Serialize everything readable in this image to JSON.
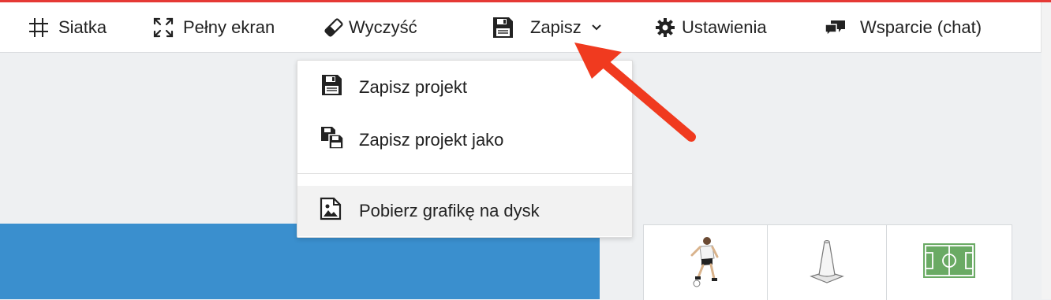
{
  "toolbar": {
    "items": [
      {
        "label": "Siatka",
        "icon": "grid-icon"
      },
      {
        "label": "Pełny ekran",
        "icon": "fullscreen-icon"
      },
      {
        "label": "Wyczyść",
        "icon": "eraser-icon"
      },
      {
        "label": "Zapisz",
        "icon": "floppy-disk-icon",
        "has_dropdown": true
      },
      {
        "label": "Ustawienia",
        "icon": "gear-icon"
      },
      {
        "label": "Wsparcie (chat)",
        "icon": "chat-bubbles-icon"
      }
    ]
  },
  "save_menu": {
    "items": [
      {
        "label": "Zapisz projekt",
        "icon": "floppy-disk-icon"
      },
      {
        "label": "Zapisz projekt jako",
        "icon": "floppy-disks-icon"
      },
      {
        "label": "Pobierz grafikę na dysk",
        "icon": "image-file-icon",
        "highlighted": true
      }
    ]
  },
  "palette": {
    "items": [
      {
        "icon": "player-icon"
      },
      {
        "icon": "cone-icon"
      },
      {
        "icon": "football-pitch-icon"
      }
    ]
  },
  "colors": {
    "accent": "#e53935",
    "arrow": "#f03a1f",
    "pitch_blue": "#3a8fce",
    "pitch_green": "#6aaa64"
  }
}
